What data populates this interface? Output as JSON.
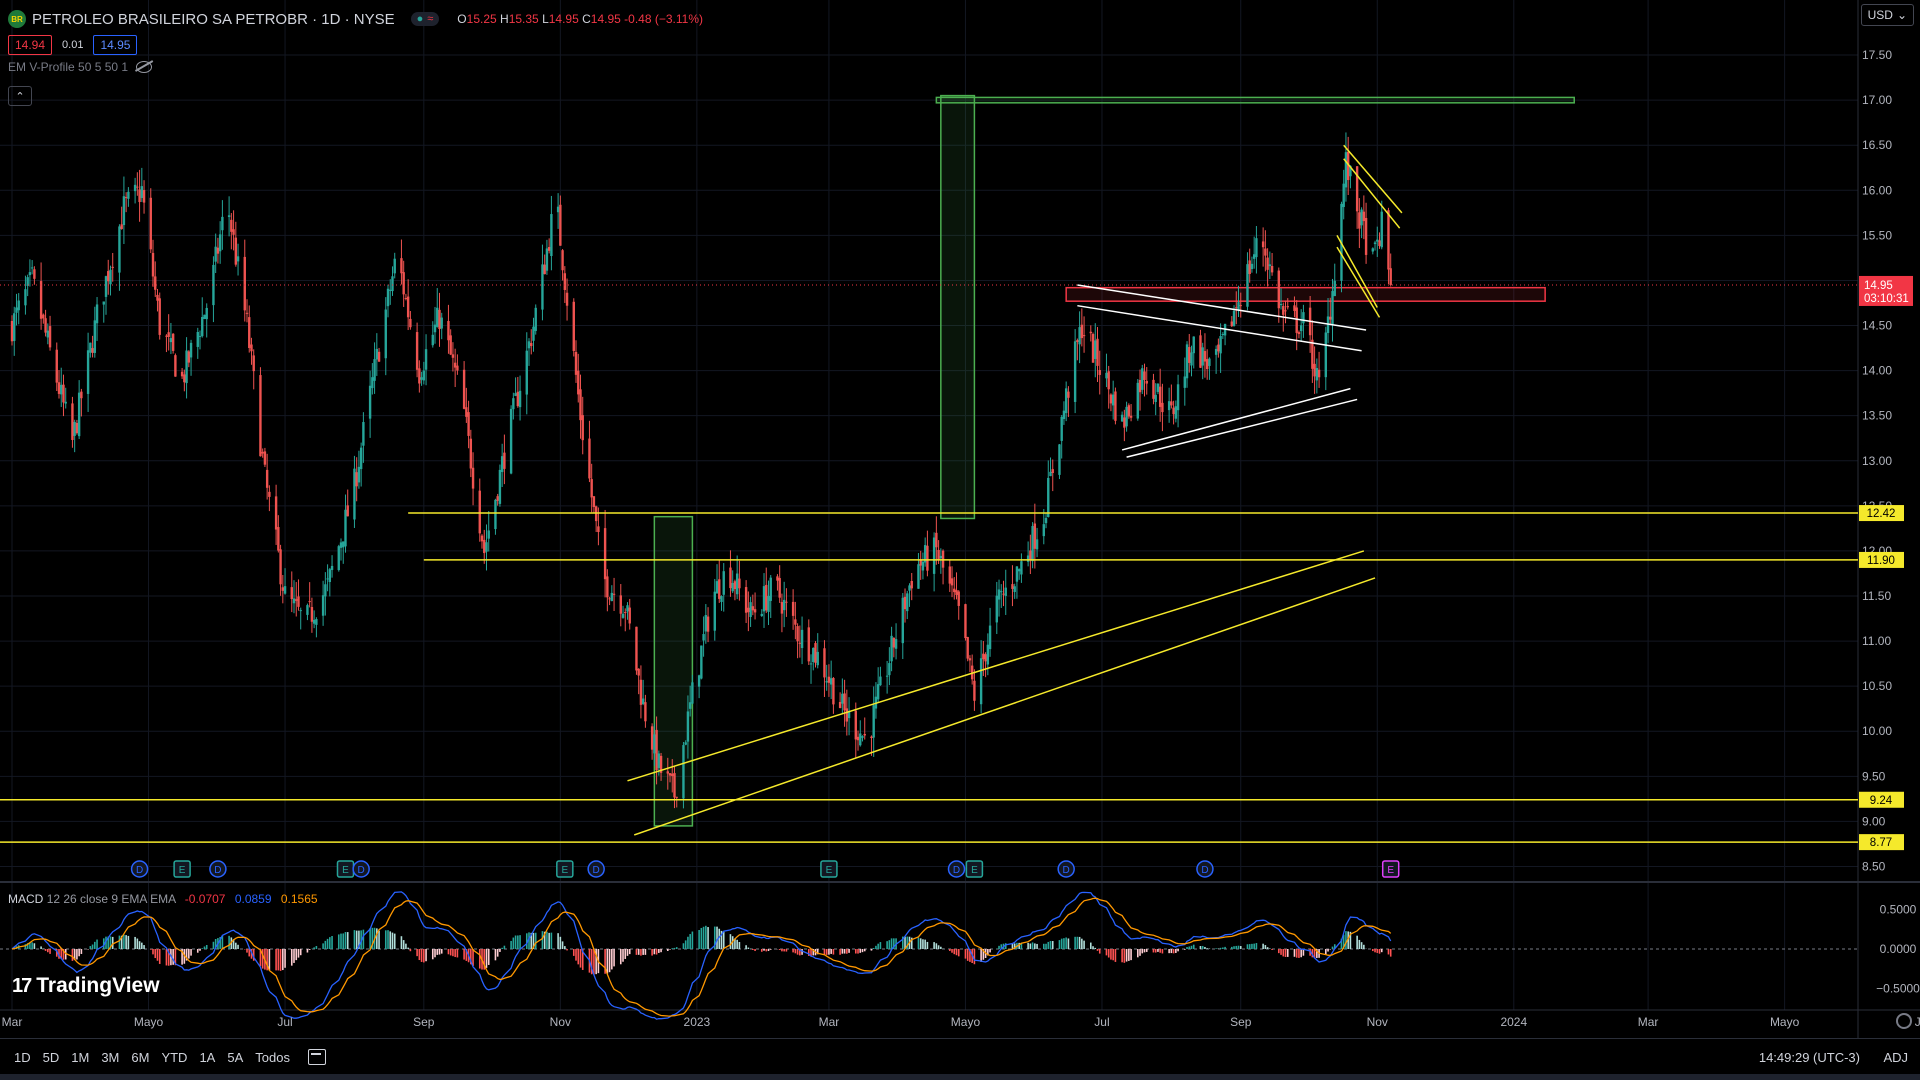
{
  "header": {
    "symbol": "PETROLEO BRASILEIRO SA PETROBR · 1D · NYSE",
    "logo_text": "BR",
    "ohlc": {
      "open_label": "O",
      "open": "15.25",
      "high_label": "H",
      "high": "15.35",
      "low_label": "L",
      "low": "14.95",
      "close_label": "C",
      "close": "14.95",
      "change": "-0.48 (−3.11%)"
    },
    "bid": "14.94",
    "spread": "0.01",
    "ask": "14.95",
    "indicator": "EM V-Profile 50 5 50 1",
    "currency": "USD"
  },
  "colors": {
    "background": "#000000",
    "up": "#26a69a",
    "down": "#ef5350",
    "yellow_line": "#f5e92b",
    "white_line": "#ffffff",
    "green_box": "#4caf50",
    "red_box": "#f23645",
    "macd_line": "#2962ff",
    "signal_line": "#ff9800"
  },
  "price_axis": {
    "ticks": [
      "17.50",
      "17.00",
      "16.50",
      "16.00",
      "15.50",
      "15.00",
      "14.50",
      "14.00",
      "13.50",
      "13.00",
      "12.50",
      "12.00",
      "11.50",
      "11.00",
      "10.50",
      "10.00",
      "9.50",
      "9.00",
      "8.50"
    ],
    "current_price": "14.95",
    "countdown": "03:10:31",
    "levels": [
      {
        "label": "12.42",
        "value": 12.42
      },
      {
        "label": "11.90",
        "value": 11.9
      },
      {
        "label": "9.24",
        "value": 9.24
      },
      {
        "label": "8.77",
        "value": 8.77
      }
    ]
  },
  "time_axis": [
    "Mar",
    "Mayo",
    "Jul",
    "Sep",
    "Nov",
    "2023",
    "Mar",
    "Mayo",
    "Jul",
    "Sep",
    "Nov",
    "2024",
    "Mar",
    "Mayo",
    "Ju"
  ],
  "events": [
    "D",
    "E",
    "D",
    "E",
    "D",
    "E",
    "D",
    "E",
    "D",
    "E",
    "D",
    "D",
    "E"
  ],
  "macd": {
    "label": "MACD",
    "params": "12 26 close 9 EMA EMA",
    "hist": "-0.0707",
    "macd": "0.0859",
    "signal": "0.1565",
    "ticks": [
      "0.5000",
      "0.0000",
      "−0.5000"
    ]
  },
  "branding": "TradingView",
  "bottom_bar": {
    "timeframes": [
      "1D",
      "5D",
      "1M",
      "3M",
      "6M",
      "YTD",
      "1A",
      "5A",
      "Todos"
    ],
    "time": "14:49:29 (UTC-3)",
    "adj": "ADJ"
  },
  "chart_data": {
    "type": "candlestick",
    "anchors": [
      [
        "2022-03-01",
        14.5
      ],
      [
        "2022-03-10",
        15.0
      ],
      [
        "2022-03-20",
        14.0
      ],
      [
        "2022-03-28",
        13.2
      ],
      [
        "2022-04-08",
        14.6
      ],
      [
        "2022-04-20",
        15.8
      ],
      [
        "2022-04-28",
        16.0
      ],
      [
        "2022-05-06",
        14.5
      ],
      [
        "2022-05-16",
        13.9
      ],
      [
        "2022-05-28",
        14.8
      ],
      [
        "2022-06-05",
        15.9
      ],
      [
        "2022-06-14",
        14.5
      ],
      [
        "2022-06-22",
        12.8
      ],
      [
        "2022-07-01",
        11.5
      ],
      [
        "2022-07-10",
        11.2
      ],
      [
        "2022-07-20",
        11.6
      ],
      [
        "2022-07-31",
        12.6
      ],
      [
        "2022-08-10",
        14.0
      ],
      [
        "2022-08-20",
        15.3
      ],
      [
        "2022-08-30",
        14.0
      ],
      [
        "2022-09-08",
        14.6
      ],
      [
        "2022-09-18",
        13.7
      ],
      [
        "2022-09-28",
        12.0
      ],
      [
        "2022-10-08",
        13.2
      ],
      [
        "2022-10-20",
        14.5
      ],
      [
        "2022-10-30",
        15.9
      ],
      [
        "2022-11-10",
        13.5
      ],
      [
        "2022-11-20",
        11.7
      ],
      [
        "2022-11-30",
        11.4
      ],
      [
        "2022-12-08",
        10.3
      ],
      [
        "2022-12-15",
        9.6
      ],
      [
        "2022-12-22",
        9.3
      ],
      [
        "2022-12-30",
        10.4
      ],
      [
        "2023-01-08",
        11.5
      ],
      [
        "2023-01-15",
        11.8
      ],
      [
        "2023-01-25",
        11.3
      ],
      [
        "2023-02-05",
        11.6
      ],
      [
        "2023-02-15",
        11.1
      ],
      [
        "2023-02-25",
        10.8
      ],
      [
        "2023-03-08",
        10.2
      ],
      [
        "2023-03-18",
        9.9
      ],
      [
        "2023-03-28",
        10.8
      ],
      [
        "2023-04-08",
        11.8
      ],
      [
        "2023-04-18",
        12.0
      ],
      [
        "2023-04-28",
        11.3
      ],
      [
        "2023-05-05",
        10.4
      ],
      [
        "2023-05-15",
        11.4
      ],
      [
        "2023-05-25",
        11.8
      ],
      [
        "2023-06-05",
        12.4
      ],
      [
        "2023-06-15",
        13.7
      ],
      [
        "2023-06-22",
        14.5
      ],
      [
        "2023-07-01",
        14.0
      ],
      [
        "2023-07-10",
        13.4
      ],
      [
        "2023-07-20",
        14.0
      ],
      [
        "2023-08-01",
        13.5
      ],
      [
        "2023-08-10",
        14.3
      ],
      [
        "2023-08-20",
        14.0
      ],
      [
        "2023-08-31",
        14.8
      ],
      [
        "2023-09-10",
        15.5
      ],
      [
        "2023-09-20",
        14.6
      ],
      [
        "2023-09-30",
        14.5
      ],
      [
        "2023-10-06",
        13.8
      ],
      [
        "2023-10-12",
        14.9
      ],
      [
        "2023-10-18",
        16.3
      ],
      [
        "2023-10-24",
        15.7
      ],
      [
        "2023-10-30",
        15.2
      ],
      [
        "2023-11-03",
        15.6
      ],
      [
        "2023-11-07",
        14.95
      ]
    ],
    "ylim": [
      8.35,
      17.8
    ]
  }
}
